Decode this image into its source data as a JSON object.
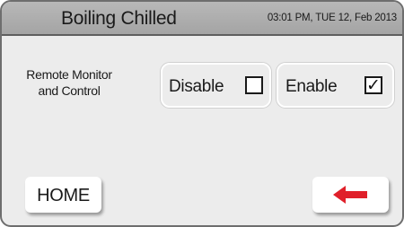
{
  "header": {
    "title": "Boiling Chilled",
    "datetime": "03:01 PM, TUE 12, Feb 2013"
  },
  "setting": {
    "label_line1": "Remote Monitor",
    "label_line2": "and Control",
    "options": [
      {
        "label": "Disable",
        "checked": false,
        "mark": ""
      },
      {
        "label": "Enable",
        "checked": true,
        "mark": "✓"
      }
    ]
  },
  "footer": {
    "home_label": "HOME",
    "back_icon": "back-arrow-icon",
    "back_icon_color": "#e0202a"
  }
}
